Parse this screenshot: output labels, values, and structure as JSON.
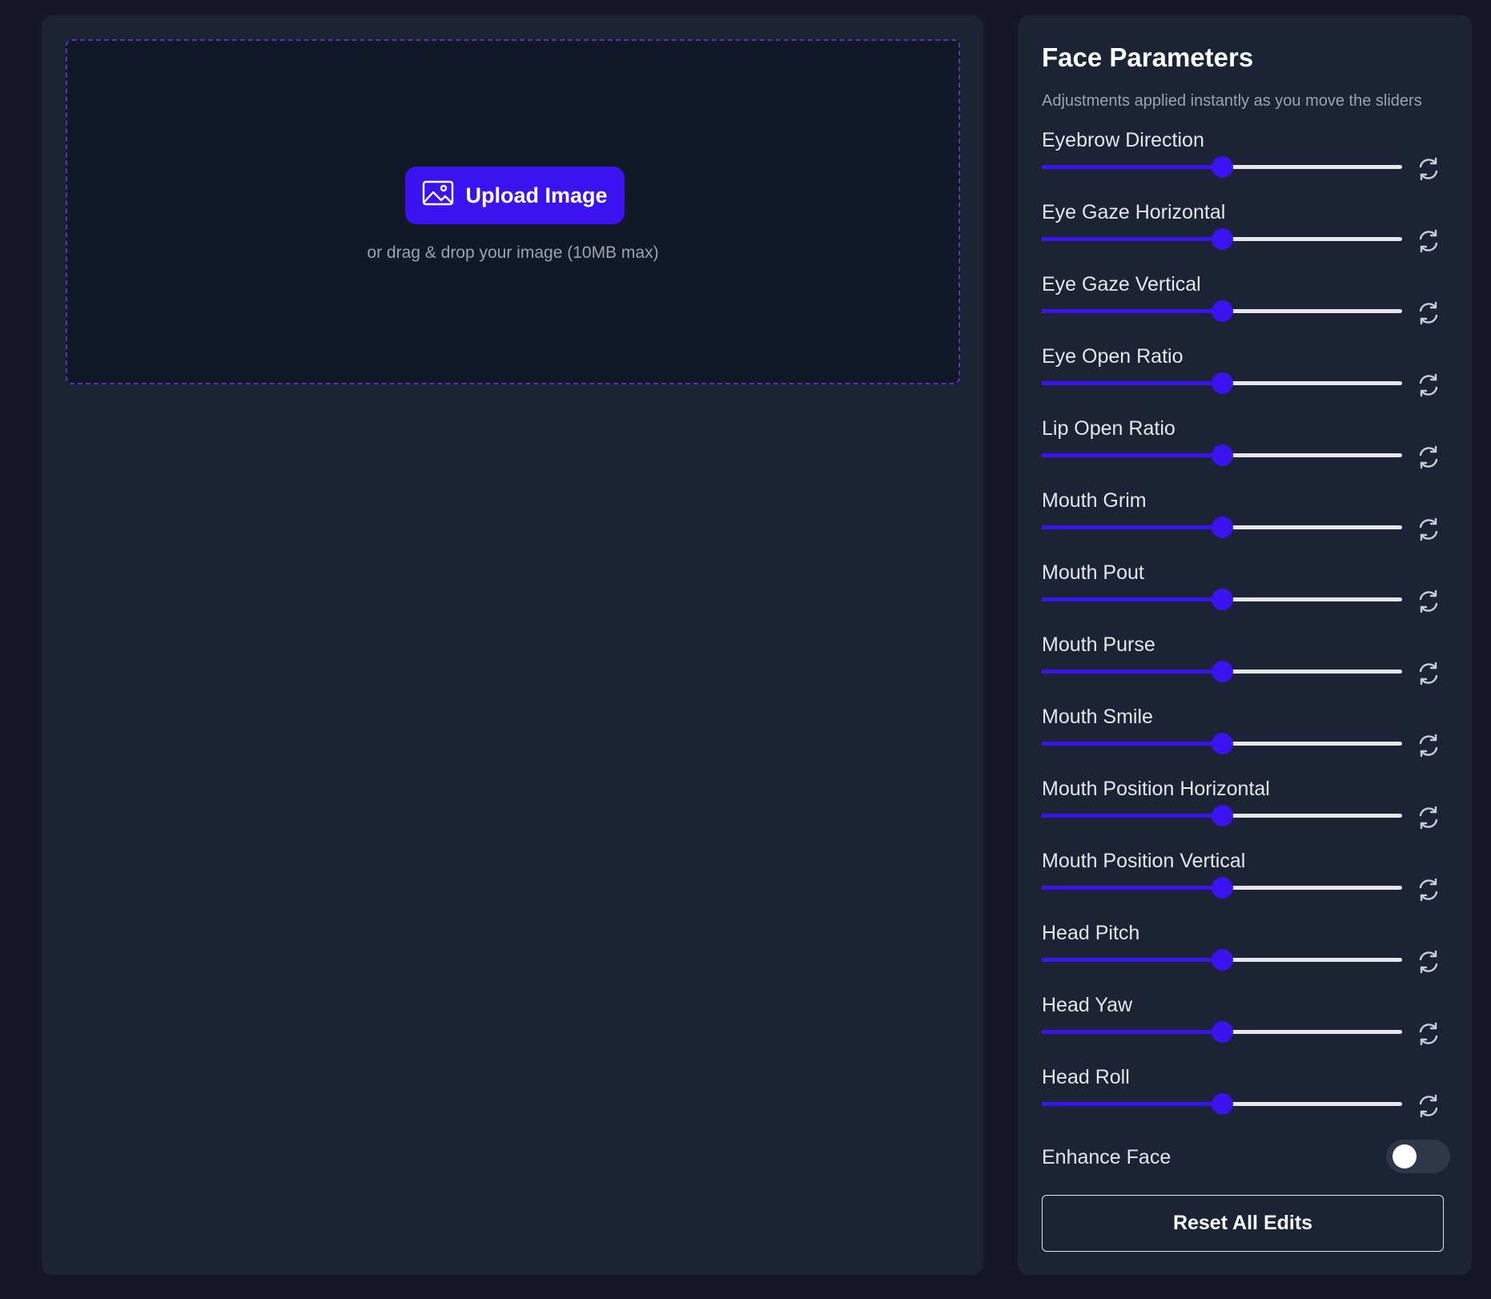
{
  "colors": {
    "background": "#161629",
    "panel": "#1b2334",
    "dropzone": "#111827",
    "accent": "#3a13f0",
    "dashed_border": "#5b2fb0",
    "muted_text": "#9ca3af"
  },
  "upload": {
    "button_label": "Upload Image",
    "button_icon": "image-icon",
    "hint": "or drag & drop your image (10MB max)"
  },
  "panel": {
    "title": "Face Parameters",
    "subtitle": "Adjustments applied instantly as you move the sliders",
    "reset_icon": "refresh-icon",
    "params": [
      {
        "label": "Eyebrow Direction",
        "value": 0.5
      },
      {
        "label": "Eye Gaze Horizontal",
        "value": 0.5
      },
      {
        "label": "Eye Gaze Vertical",
        "value": 0.5
      },
      {
        "label": "Eye Open Ratio",
        "value": 0.5
      },
      {
        "label": "Lip Open Ratio",
        "value": 0.5
      },
      {
        "label": "Mouth Grim",
        "value": 0.5
      },
      {
        "label": "Mouth Pout",
        "value": 0.5
      },
      {
        "label": "Mouth Purse",
        "value": 0.5
      },
      {
        "label": "Mouth Smile",
        "value": 0.5
      },
      {
        "label": "Mouth Position Horizontal",
        "value": 0.5
      },
      {
        "label": "Mouth Position Vertical",
        "value": 0.5
      },
      {
        "label": "Head Pitch",
        "value": 0.5
      },
      {
        "label": "Head Yaw",
        "value": 0.5
      },
      {
        "label": "Head Roll",
        "value": 0.5
      }
    ],
    "enhance": {
      "label": "Enhance Face",
      "enabled": false
    },
    "reset_all_label": "Reset All Edits"
  }
}
